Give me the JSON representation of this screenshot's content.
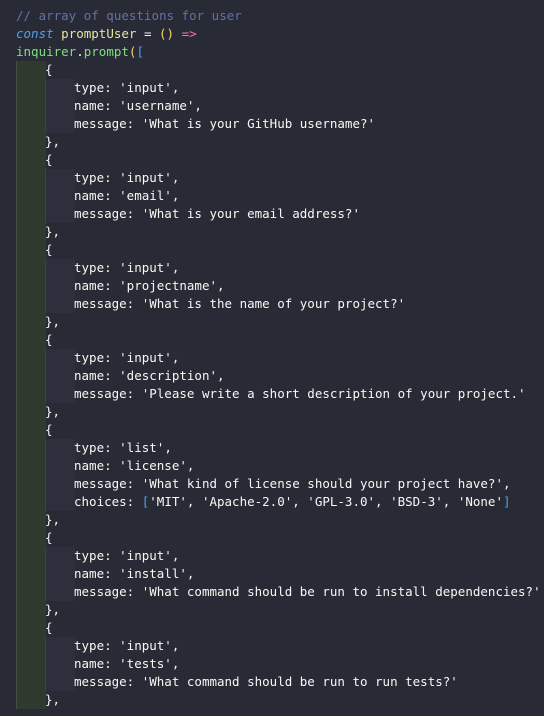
{
  "code": {
    "language": "javascript",
    "lines": [
      {
        "indent": 0,
        "tokens": [
          {
            "t": "// array of questions for user",
            "c": "comment"
          }
        ]
      },
      {
        "indent": 0,
        "tokens": [
          {
            "t": "const",
            "c": "kw"
          },
          {
            "t": " ",
            "c": "punc"
          },
          {
            "t": "promptUser",
            "c": "ident"
          },
          {
            "t": " = ",
            "c": "punc"
          },
          {
            "t": "()",
            "c": "paren"
          },
          {
            "t": " ",
            "c": "punc"
          },
          {
            "t": "=>",
            "c": "op"
          }
        ]
      },
      {
        "indent": 0,
        "tokens": [
          {
            "t": "inquirer",
            "c": "fn"
          },
          {
            "t": ".",
            "c": "punc"
          },
          {
            "t": "prompt",
            "c": "fn"
          },
          {
            "t": "(",
            "c": "paren"
          },
          {
            "t": "[",
            "c": "bracket"
          }
        ]
      },
      {
        "indent": 1,
        "tokens": [
          {
            "t": "{",
            "c": "punc"
          }
        ]
      },
      {
        "indent": 2,
        "tokens": [
          {
            "t": "type: ",
            "c": "prop"
          },
          {
            "t": "'input'",
            "c": "str"
          },
          {
            "t": ",",
            "c": "punc"
          }
        ]
      },
      {
        "indent": 2,
        "tokens": [
          {
            "t": "name: ",
            "c": "prop"
          },
          {
            "t": "'username'",
            "c": "str"
          },
          {
            "t": ",",
            "c": "punc"
          }
        ]
      },
      {
        "indent": 2,
        "tokens": [
          {
            "t": "message: ",
            "c": "prop"
          },
          {
            "t": "'What is your GitHub username?'",
            "c": "str"
          }
        ]
      },
      {
        "indent": 1,
        "tokens": [
          {
            "t": "},",
            "c": "punc"
          }
        ]
      },
      {
        "indent": 1,
        "tokens": [
          {
            "t": "{",
            "c": "punc"
          }
        ]
      },
      {
        "indent": 2,
        "tokens": [
          {
            "t": "type: ",
            "c": "prop"
          },
          {
            "t": "'input'",
            "c": "str"
          },
          {
            "t": ",",
            "c": "punc"
          }
        ]
      },
      {
        "indent": 2,
        "tokens": [
          {
            "t": "name: ",
            "c": "prop"
          },
          {
            "t": "'email'",
            "c": "str"
          },
          {
            "t": ",",
            "c": "punc"
          }
        ]
      },
      {
        "indent": 2,
        "tokens": [
          {
            "t": "message: ",
            "c": "prop"
          },
          {
            "t": "'What is your email address?'",
            "c": "str"
          }
        ]
      },
      {
        "indent": 1,
        "tokens": [
          {
            "t": "},",
            "c": "punc"
          }
        ]
      },
      {
        "indent": 1,
        "tokens": [
          {
            "t": "{",
            "c": "punc"
          }
        ]
      },
      {
        "indent": 2,
        "tokens": [
          {
            "t": "type: ",
            "c": "prop"
          },
          {
            "t": "'input'",
            "c": "str"
          },
          {
            "t": ",",
            "c": "punc"
          }
        ]
      },
      {
        "indent": 2,
        "tokens": [
          {
            "t": "name: ",
            "c": "prop"
          },
          {
            "t": "'projectname'",
            "c": "str"
          },
          {
            "t": ",",
            "c": "punc"
          }
        ]
      },
      {
        "indent": 2,
        "tokens": [
          {
            "t": "message: ",
            "c": "prop"
          },
          {
            "t": "'What is the name of your project?'",
            "c": "str"
          }
        ]
      },
      {
        "indent": 1,
        "tokens": [
          {
            "t": "},",
            "c": "punc"
          }
        ]
      },
      {
        "indent": 1,
        "tokens": [
          {
            "t": "{",
            "c": "punc"
          }
        ]
      },
      {
        "indent": 2,
        "tokens": [
          {
            "t": "type: ",
            "c": "prop"
          },
          {
            "t": "'input'",
            "c": "str"
          },
          {
            "t": ",",
            "c": "punc"
          }
        ]
      },
      {
        "indent": 2,
        "tokens": [
          {
            "t": "name: ",
            "c": "prop"
          },
          {
            "t": "'description'",
            "c": "str"
          },
          {
            "t": ",",
            "c": "punc"
          }
        ]
      },
      {
        "indent": 2,
        "tokens": [
          {
            "t": "message: ",
            "c": "prop"
          },
          {
            "t": "'Please write a short description of your project.'",
            "c": "str"
          }
        ]
      },
      {
        "indent": 1,
        "tokens": [
          {
            "t": "},",
            "c": "punc"
          }
        ]
      },
      {
        "indent": 1,
        "tokens": [
          {
            "t": "{",
            "c": "punc"
          }
        ]
      },
      {
        "indent": 2,
        "tokens": [
          {
            "t": "type: ",
            "c": "prop"
          },
          {
            "t": "'list'",
            "c": "str"
          },
          {
            "t": ",",
            "c": "punc"
          }
        ]
      },
      {
        "indent": 2,
        "tokens": [
          {
            "t": "name: ",
            "c": "prop"
          },
          {
            "t": "'license'",
            "c": "str"
          },
          {
            "t": ",",
            "c": "punc"
          }
        ]
      },
      {
        "indent": 2,
        "tokens": [
          {
            "t": "message: ",
            "c": "prop"
          },
          {
            "t": "'What kind of license should your project have?'",
            "c": "str"
          },
          {
            "t": ",",
            "c": "punc"
          }
        ]
      },
      {
        "indent": 2,
        "tokens": [
          {
            "t": "choices: ",
            "c": "prop"
          },
          {
            "t": "[",
            "c": "bracket"
          },
          {
            "t": "'MIT', 'Apache-2.0', 'GPL-3.0', 'BSD-3', 'None'",
            "c": "str"
          },
          {
            "t": "]",
            "c": "bracket"
          }
        ]
      },
      {
        "indent": 1,
        "tokens": [
          {
            "t": "},",
            "c": "punc"
          }
        ]
      },
      {
        "indent": 1,
        "tokens": [
          {
            "t": "{",
            "c": "punc"
          }
        ]
      },
      {
        "indent": 2,
        "tokens": [
          {
            "t": "type: ",
            "c": "prop"
          },
          {
            "t": "'input'",
            "c": "str"
          },
          {
            "t": ",",
            "c": "punc"
          }
        ]
      },
      {
        "indent": 2,
        "tokens": [
          {
            "t": "name: ",
            "c": "prop"
          },
          {
            "t": "'install'",
            "c": "str"
          },
          {
            "t": ",",
            "c": "punc"
          }
        ]
      },
      {
        "indent": 2,
        "tokens": [
          {
            "t": "message: ",
            "c": "prop"
          },
          {
            "t": "'What command should be run to install dependencies?'",
            "c": "str"
          }
        ]
      },
      {
        "indent": 1,
        "tokens": [
          {
            "t": "},",
            "c": "punc"
          }
        ]
      },
      {
        "indent": 1,
        "tokens": [
          {
            "t": "{",
            "c": "punc"
          }
        ]
      },
      {
        "indent": 2,
        "tokens": [
          {
            "t": "type: ",
            "c": "prop"
          },
          {
            "t": "'input'",
            "c": "str"
          },
          {
            "t": ",",
            "c": "punc"
          }
        ]
      },
      {
        "indent": 2,
        "tokens": [
          {
            "t": "name: ",
            "c": "prop"
          },
          {
            "t": "'tests'",
            "c": "str"
          },
          {
            "t": ",",
            "c": "punc"
          }
        ]
      },
      {
        "indent": 2,
        "tokens": [
          {
            "t": "message: ",
            "c": "prop"
          },
          {
            "t": "'What command should be run to run tests?'",
            "c": "str"
          }
        ]
      },
      {
        "indent": 1,
        "tokens": [
          {
            "t": "},",
            "c": "punc"
          }
        ]
      }
    ]
  },
  "colors": {
    "background": "#282a36",
    "comment": "#6272a4",
    "keyword": "#4ea1f3",
    "function": "#7ee07b",
    "string": "#f8f8f2"
  }
}
